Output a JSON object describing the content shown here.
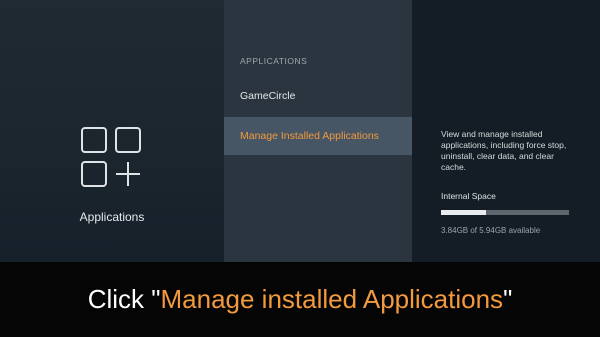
{
  "left_panel": {
    "icon": "apps-grid-plus-icon",
    "label": "Applications"
  },
  "menu": {
    "header": "APPLICATIONS",
    "items": [
      {
        "label": "GameCircle",
        "selected": false
      },
      {
        "label": "Manage Installed Applications",
        "selected": true
      }
    ]
  },
  "details": {
    "description": "View and manage installed applications, including force stop, uninstall, clear data, and clear cache.",
    "storage_label": "Internal Space",
    "storage_text": "3.84GB of 5.94GB available",
    "storage_used_fraction": 0.35
  },
  "caption": {
    "prefix": "Click \"",
    "highlight": "Manage installed Applications",
    "suffix": "\""
  },
  "colors": {
    "accent": "#f29a3d",
    "selected_bg": "#475664"
  }
}
